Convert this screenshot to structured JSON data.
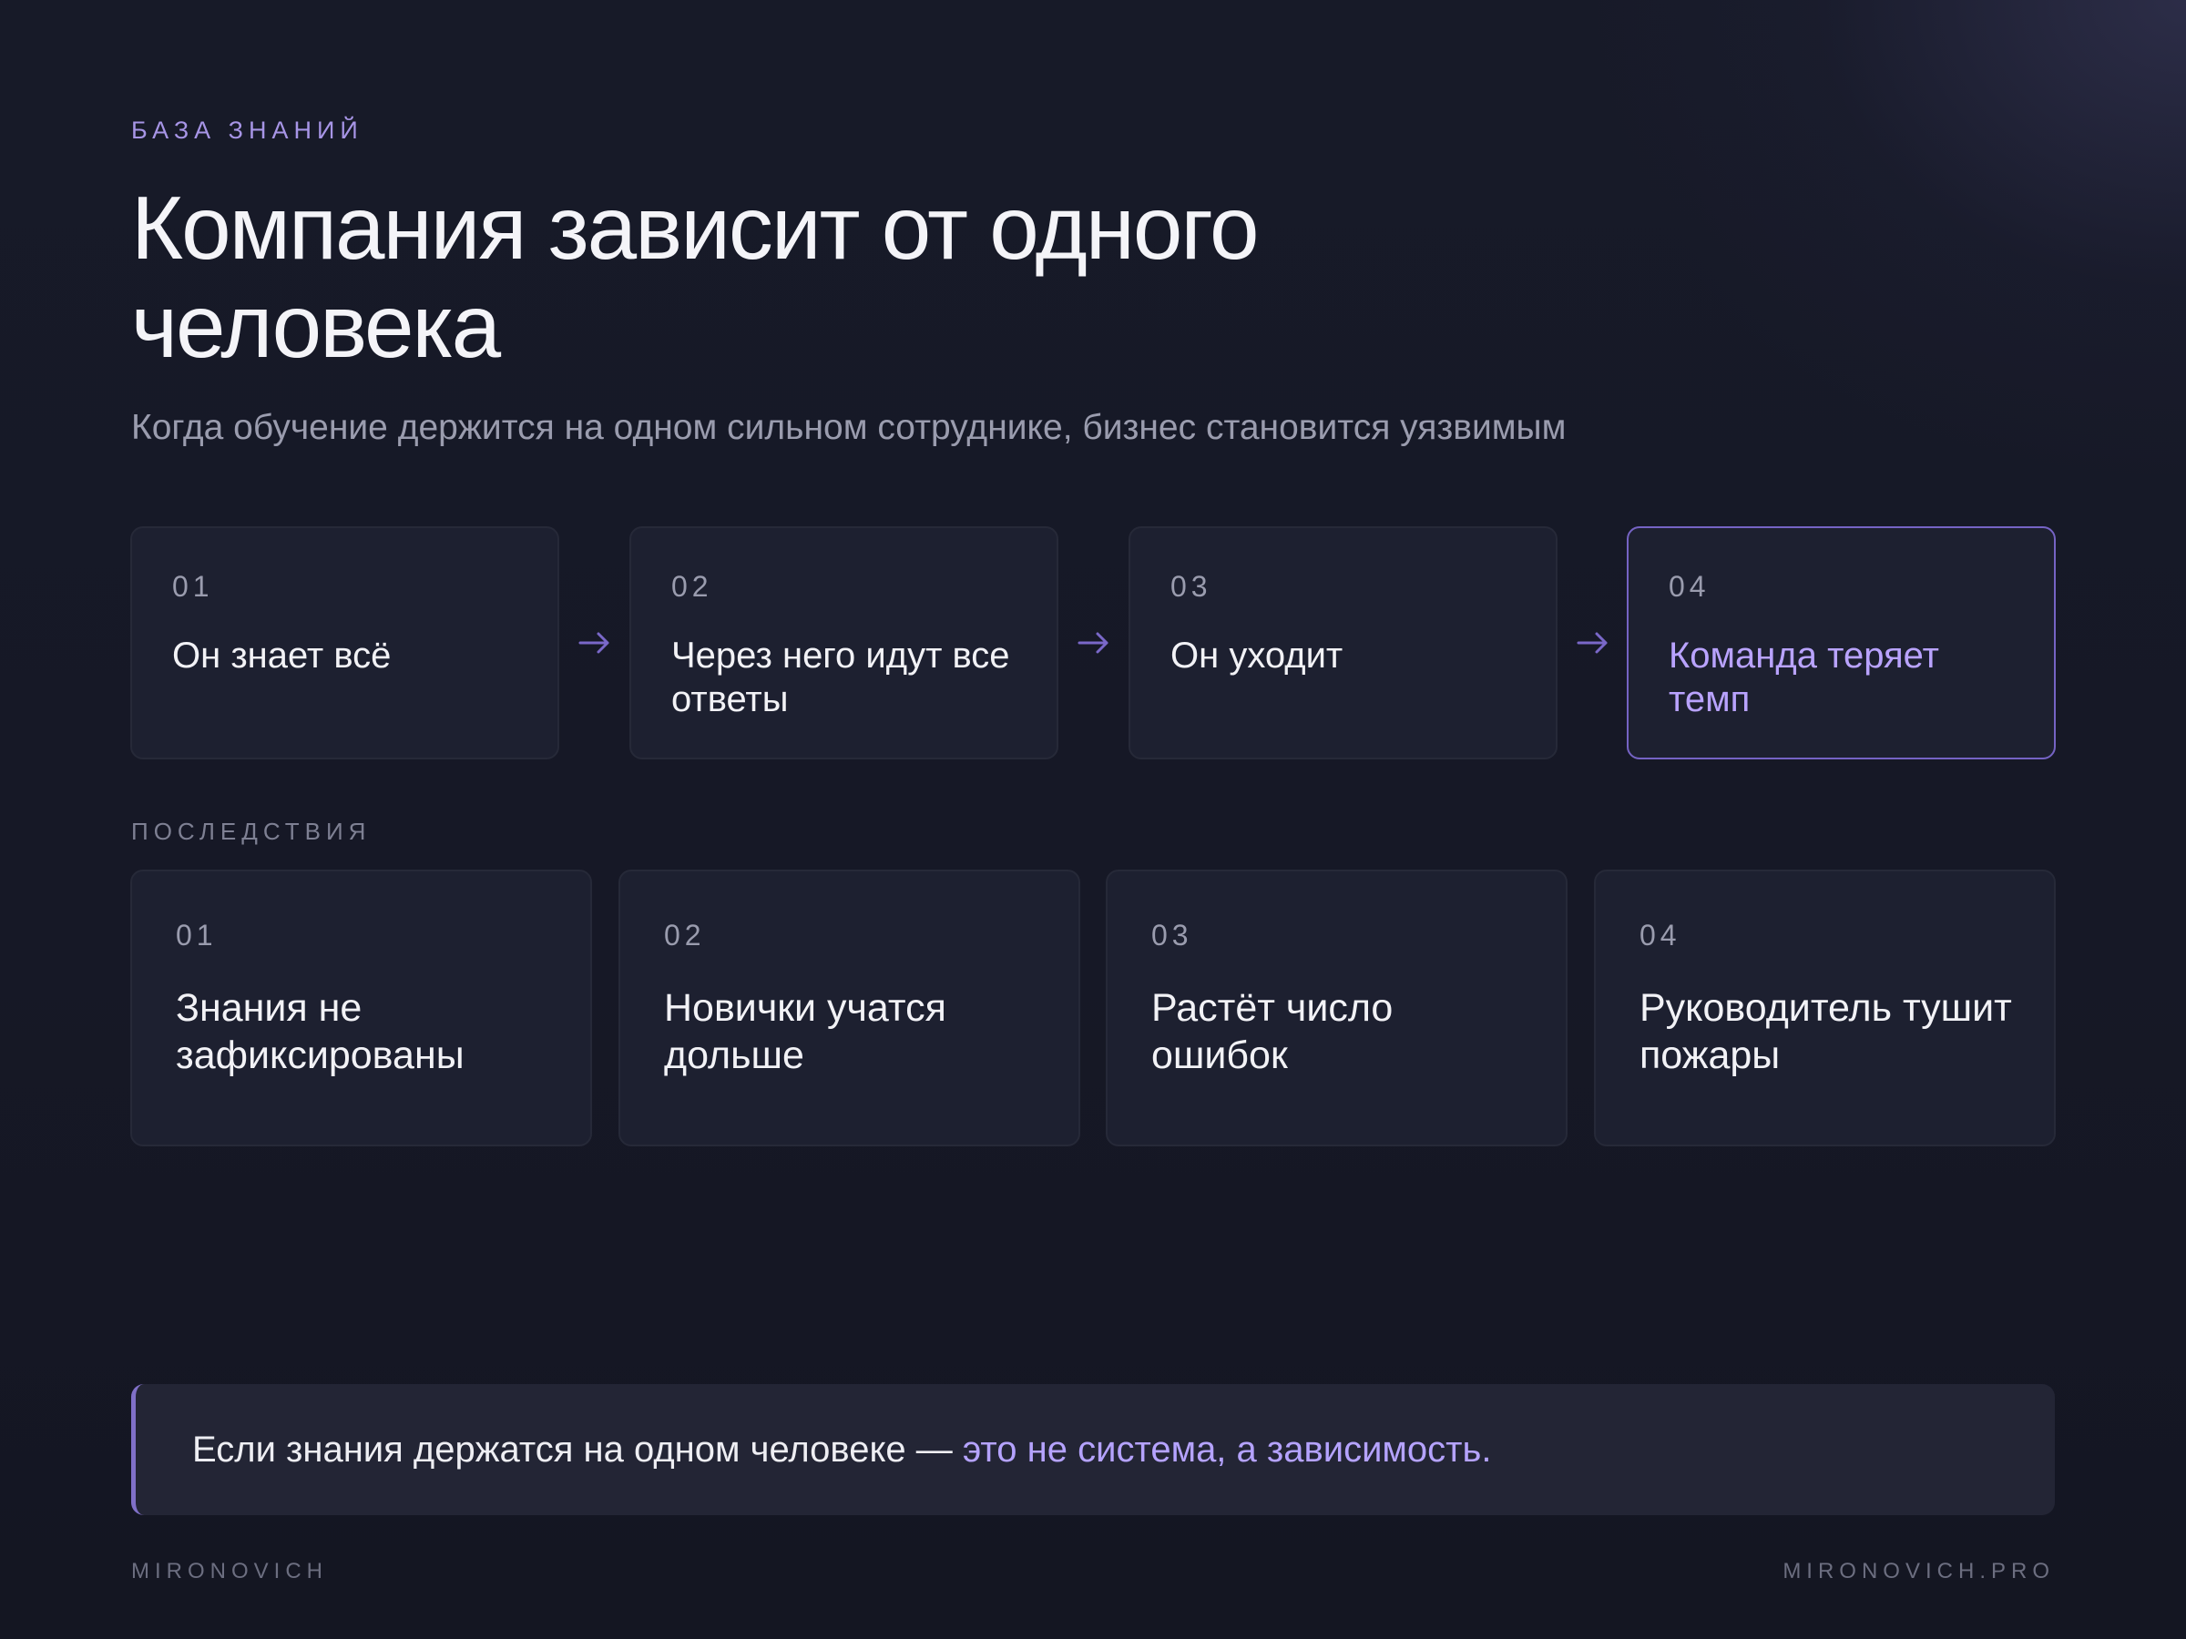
{
  "header": {
    "eyebrow": "БАЗА ЗНАНИЙ",
    "title": "Компания зависит от одного человека",
    "subtitle": "Когда обучение держится на одном сильном сотруднике, бизнес становится уязвимым"
  },
  "steps": [
    {
      "num": "01",
      "text": "Он знает всё"
    },
    {
      "num": "02",
      "text": "Через него идут все ответы"
    },
    {
      "num": "03",
      "text": "Он уходит"
    },
    {
      "num": "04",
      "text": "Команда теряет темп"
    }
  ],
  "consequences": {
    "label": "ПОСЛЕДСТВИЯ",
    "items": [
      {
        "num": "01",
        "text": "Знания не зафиксированы"
      },
      {
        "num": "02",
        "text": "Новички учатся дольше"
      },
      {
        "num": "03",
        "text": "Растёт число ошибок"
      },
      {
        "num": "04",
        "text": "Руководитель тушит пожары"
      }
    ]
  },
  "callout": {
    "lead": "Если знания держатся на одном человеке — ",
    "highlight": "это не система, а зависимость."
  },
  "footer": {
    "left": "MIRONOVICH",
    "right": "MIRONOVICH.PRO"
  },
  "colors": {
    "background": "#161826",
    "accent": "#b5a3ff",
    "card": "#1d2030"
  },
  "icons": {
    "step_arrow": "arrow-right-icon"
  }
}
